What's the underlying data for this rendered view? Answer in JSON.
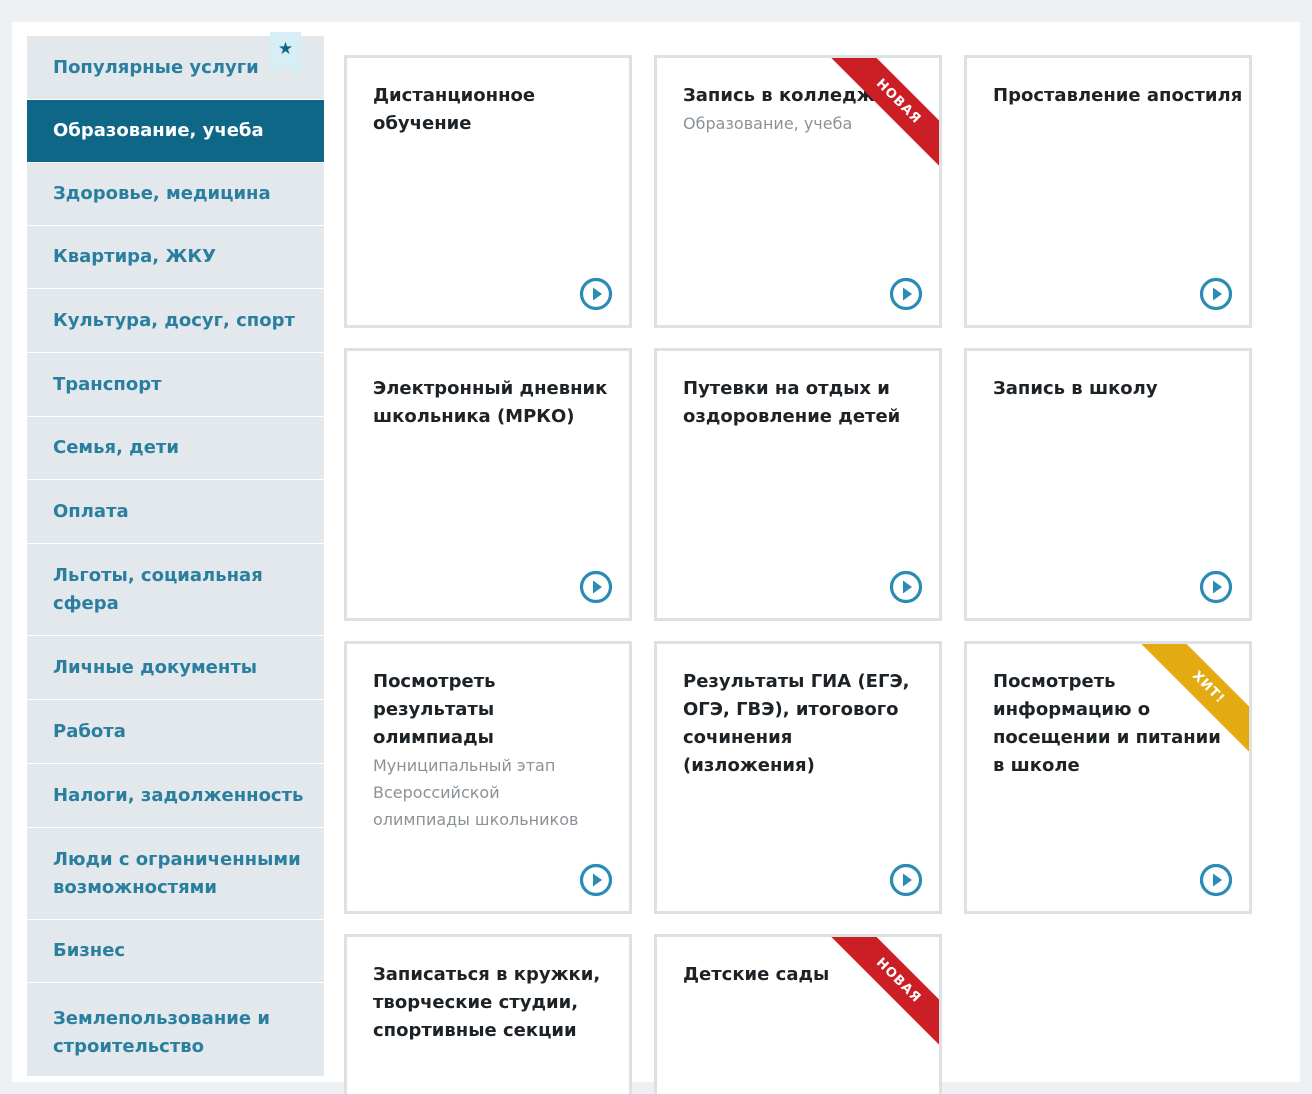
{
  "colors": {
    "active_bg": "#0f6788",
    "link": "#2a7f9f",
    "ribbon_new": "#cc1f25",
    "ribbon_hit": "#e3aa12",
    "play_icon": "#2a8cb5"
  },
  "sidebar": {
    "items": [
      {
        "label": "Популярные услуги"
      },
      {
        "label": "Образование, учеба",
        "active": true
      },
      {
        "label": "Здоровье, медицина"
      },
      {
        "label": "Квартира, ЖКУ"
      },
      {
        "label": "Культура, досуг, спорт"
      },
      {
        "label": "Транспорт"
      },
      {
        "label": "Семья, дети"
      },
      {
        "label": "Оплата"
      },
      {
        "label": "Льготы, социальная сфера"
      },
      {
        "label": "Личные документы"
      },
      {
        "label": "Работа"
      },
      {
        "label": "Налоги, задолженность"
      },
      {
        "label": "Люди с ограниченными возможностями"
      },
      {
        "label": "Бизнес"
      },
      {
        "label": "Землепользование и строительство"
      }
    ],
    "bookmark_icon": "star-bookmark-icon"
  },
  "cards": [
    {
      "title": "Дистанционное обучение",
      "subtitle": ""
    },
    {
      "title": "Запись в колледж",
      "subtitle": "Образование, учеба",
      "ribbon": "НОВАЯ"
    },
    {
      "title": "Проставление апостиля",
      "subtitle": ""
    },
    {
      "title": "Электронный дневник школьника (МРКО)",
      "subtitle": ""
    },
    {
      "title": "Путевки на отдых и оздоровление детей",
      "subtitle": ""
    },
    {
      "title": "Запись в школу",
      "subtitle": ""
    },
    {
      "title": "Посмотреть результаты олимпиады",
      "subtitle": "Муниципальный этап Всероссийской олимпиады школьников"
    },
    {
      "title": "Результаты ГИА (ЕГЭ, ОГЭ, ГВЭ), итогового сочинения (изложения)",
      "subtitle": ""
    },
    {
      "title": "Посмотреть информацию о посещении и питании в школе",
      "subtitle": "",
      "ribbon": "ХИТ!"
    },
    {
      "title": "Записаться в кружки, творческие студии, спортивные секции",
      "subtitle": ""
    },
    {
      "title": "Детские сады",
      "subtitle": "",
      "ribbon": "НОВАЯ"
    }
  ]
}
